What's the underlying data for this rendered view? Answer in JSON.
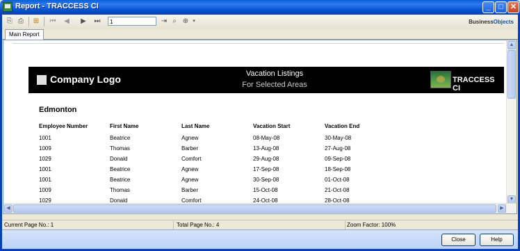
{
  "window": {
    "title": "Report - TRACCESS CI"
  },
  "toolbar": {
    "page_value": "1",
    "brand": "Business",
    "brand_suffix": "Objects"
  },
  "tabs": [
    {
      "label": "Main Report"
    }
  ],
  "report": {
    "logo_text": "Company Logo",
    "title": "Vacation Listings",
    "subtitle": "For Selected Areas",
    "brand_text": "TRACCESS CI",
    "city": "Edmonton",
    "columns": [
      "Employee Number",
      "First Name",
      "Last Name",
      "Vacation Start",
      "Vacation End"
    ],
    "rows": [
      [
        "1001",
        "Beatrice",
        "Agnew",
        "08-May-08",
        "30-May-08"
      ],
      [
        "1009",
        "Thomas",
        "Barber",
        "13-Aug-08",
        "27-Aug-08"
      ],
      [
        "1029",
        "Donald",
        "Comfort",
        "29-Aug-08",
        "09-Sep-08"
      ],
      [
        "1001",
        "Beatrice",
        "Agnew",
        "17-Sep-08",
        "18-Sep-08"
      ],
      [
        "1001",
        "Beatrice",
        "Agnew",
        "30-Sep-08",
        "01-Oct-08"
      ],
      [
        "1009",
        "Thomas",
        "Barber",
        "15-Oct-08",
        "21-Oct-08"
      ],
      [
        "1029",
        "Donald",
        "Comfort",
        "24-Oct-08",
        "28-Oct-08"
      ]
    ]
  },
  "status": {
    "current_page": "Current Page No.: 1",
    "total_page": "Total Page No.: 4",
    "zoom": "Zoom Factor: 100%"
  },
  "buttons": {
    "close": "Close",
    "help": "Help"
  }
}
